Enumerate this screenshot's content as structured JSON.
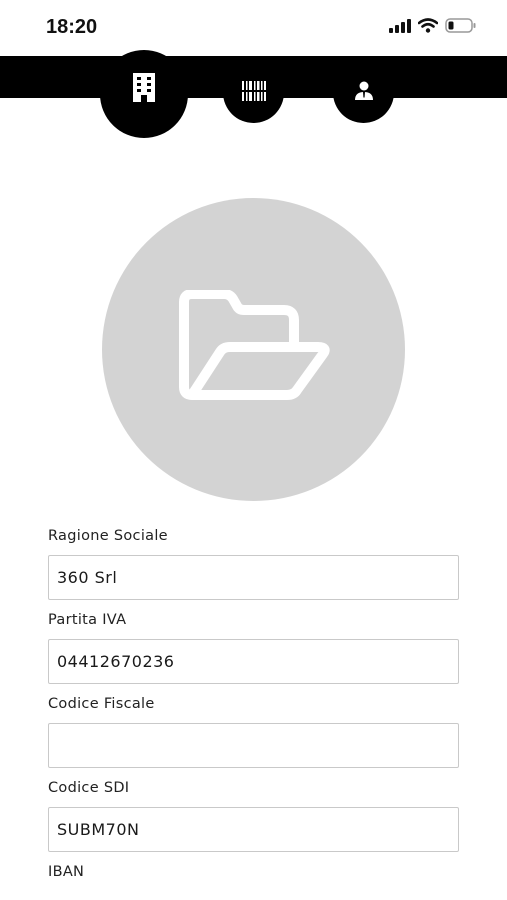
{
  "status_bar": {
    "time": "18:20",
    "icons": [
      "cellular-signal-icon",
      "wifi-icon",
      "battery-icon"
    ]
  },
  "tabs": [
    {
      "name": "company",
      "icon": "building-icon",
      "active": true
    },
    {
      "name": "barcode",
      "icon": "barcode-icon",
      "active": false
    },
    {
      "name": "user",
      "icon": "user-icon",
      "active": false
    }
  ],
  "logo": {
    "icon": "folder-open-icon",
    "background": "#d3d3d3"
  },
  "form": {
    "ragione_sociale": {
      "label": "Ragione Sociale",
      "value": "360 Srl"
    },
    "partita_iva": {
      "label": "Partita IVA",
      "value": "04412670236"
    },
    "codice_fiscale": {
      "label": "Codice Fiscale",
      "value": ""
    },
    "codice_sdi": {
      "label": "Codice SDI",
      "value": "SUBM70N"
    },
    "iban": {
      "label": "IBAN"
    }
  },
  "colors": {
    "accent": "#000000",
    "logo_bg": "#d3d3d3",
    "border": "#c9c9c9"
  }
}
